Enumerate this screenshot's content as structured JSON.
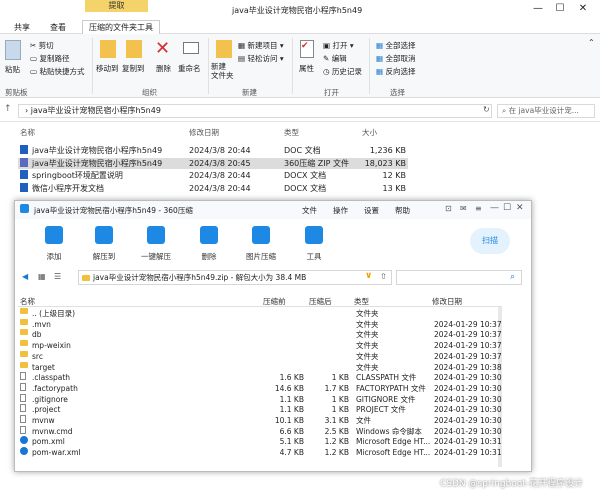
{
  "window": {
    "title": "java毕业设计宠物民宿小程序h5n49",
    "ctx_tab": "提取"
  },
  "ribbon_tabs": [
    "共享",
    "查看",
    "压缩的文件夹工具"
  ],
  "ribbon": {
    "paste": "粘贴",
    "cut": "剪切",
    "copy_path": "复制路径",
    "paste_shortcut": "粘贴快捷方式",
    "move_to": "移动到",
    "copy_to": "复制到",
    "delete": "删除",
    "rename": "重命名",
    "new_item": "新建项目",
    "easy_access": "轻松访问",
    "new_folder": "新建\n文件夹",
    "properties": "属性",
    "open": "打开",
    "edit": "编辑",
    "history": "历史记录",
    "select_all": "全部选择",
    "select_none": "全部取消",
    "invert": "反向选择",
    "groups": {
      "clipboard": "剪贴板",
      "organize": "组织",
      "new": "新建",
      "open": "打开",
      "select": "选择"
    }
  },
  "address": {
    "path": "java毕业设计宠物民宿小程序h5n49",
    "search": "在 java毕业设计宠..."
  },
  "columns": {
    "name": "名称",
    "date": "修改日期",
    "type": "类型",
    "size": "大小"
  },
  "files": [
    {
      "name": "java毕业设计宠物民宿小程序h5n49",
      "date": "2024/3/8 20:44",
      "type": "DOC 文档",
      "size": "1,236 KB",
      "icon": "word-icon"
    },
    {
      "name": "java毕业设计宠物民宿小程序h5n49",
      "date": "2024/3/8 20:45",
      "type": "360压缩 ZIP 文件",
      "size": "18,023 KB",
      "icon": "zip-icon"
    },
    {
      "name": "springboot环境配置说明",
      "date": "2024/3/8 20:44",
      "type": "DOCX 文档",
      "size": "12 KB",
      "icon": "word-icon"
    },
    {
      "name": "微信小程序开发文档",
      "date": "2024/3/8 20:44",
      "type": "DOCX 文档",
      "size": "13 KB",
      "icon": "word-icon"
    }
  ],
  "zip": {
    "title": "java毕业设计宠物民宿小程序h5n49 - 360压缩",
    "menu": [
      "文件",
      "操作",
      "设置",
      "帮助"
    ],
    "tools": [
      "添加",
      "解压到",
      "一键解压",
      "删除",
      "图片压缩",
      "工具"
    ],
    "scan": "扫描",
    "path": "java毕业设计宠物民宿小程序h5n49.zip - 解包大小为 38.4 MB",
    "cols": {
      "name": "名称",
      "packed": "压缩前",
      "unpacked": "压缩后",
      "type": "类型",
      "date": "修改日期"
    },
    "rows": [
      {
        "name": ".. (上级目录)",
        "packed": "",
        "unpacked": "",
        "type": "文件夹",
        "date": "",
        "kind": "folder"
      },
      {
        "name": ".mvn",
        "packed": "",
        "unpacked": "",
        "type": "文件夹",
        "date": "2024-01-29 10:37",
        "kind": "folder"
      },
      {
        "name": "db",
        "packed": "",
        "unpacked": "",
        "type": "文件夹",
        "date": "2024-01-29 10:37",
        "kind": "folder"
      },
      {
        "name": "mp-weixin",
        "packed": "",
        "unpacked": "",
        "type": "文件夹",
        "date": "2024-01-29 10:37",
        "kind": "folder"
      },
      {
        "name": "src",
        "packed": "",
        "unpacked": "",
        "type": "文件夹",
        "date": "2024-01-29 10:37",
        "kind": "folder"
      },
      {
        "name": "target",
        "packed": "",
        "unpacked": "",
        "type": "文件夹",
        "date": "2024-01-29 10:38",
        "kind": "folder"
      },
      {
        "name": ".classpath",
        "packed": "1.6 KB",
        "unpacked": "1 KB",
        "type": "CLASSPATH 文件",
        "date": "2024-01-29 10:30",
        "kind": "file"
      },
      {
        "name": ".factorypath",
        "packed": "14.6 KB",
        "unpacked": "1.7 KB",
        "type": "FACTORYPATH 文件",
        "date": "2024-01-29 10:30",
        "kind": "file"
      },
      {
        "name": ".gitignore",
        "packed": "1.1 KB",
        "unpacked": "1 KB",
        "type": "GITIGNORE 文件",
        "date": "2024-01-29 10:30",
        "kind": "file"
      },
      {
        "name": ".project",
        "packed": "1.1 KB",
        "unpacked": "1 KB",
        "type": "PROJECT 文件",
        "date": "2024-01-29 10:30",
        "kind": "file"
      },
      {
        "name": "mvnw",
        "packed": "10.1 KB",
        "unpacked": "3.1 KB",
        "type": "文件",
        "date": "2024-01-29 10:30",
        "kind": "file"
      },
      {
        "name": "mvnw.cmd",
        "packed": "6.6 KB",
        "unpacked": "2.5 KB",
        "type": "Windows 命令脚本",
        "date": "2024-01-29 10:30",
        "kind": "file"
      },
      {
        "name": "pom.xml",
        "packed": "5.1 KB",
        "unpacked": "1.2 KB",
        "type": "Microsoft Edge HT...",
        "date": "2024-01-29 10:31",
        "kind": "edge"
      },
      {
        "name": "pom-war.xml",
        "packed": "4.7 KB",
        "unpacked": "1.2 KB",
        "type": "Microsoft Edge HT...",
        "date": "2024-01-29 10:31",
        "kind": "edge"
      }
    ]
  },
  "watermark": "CSDN @springboot-花开程序设计"
}
